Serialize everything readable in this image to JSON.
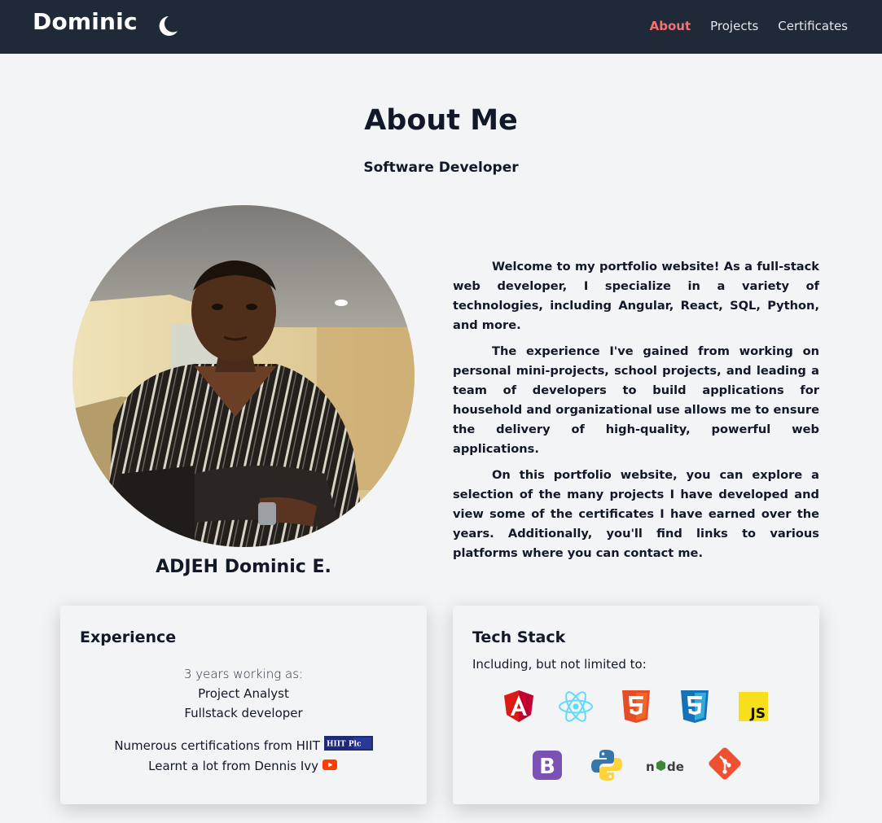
{
  "nav": {
    "brand": "Dominic",
    "theme_icon": "moon-icon",
    "links": [
      {
        "label": "About",
        "active": true
      },
      {
        "label": "Projects",
        "active": false
      },
      {
        "label": "Certificates",
        "active": false
      }
    ],
    "colors": {
      "background": "#1f2937",
      "active": "#f87171",
      "link": "#e5e7eb"
    }
  },
  "header": {
    "title": "About Me",
    "subtitle": "Software Developer"
  },
  "profile": {
    "photo_icon": "profile-photo",
    "name": "ADJEH Dominic E."
  },
  "bio": {
    "paragraphs": [
      "Welcome to my portfolio website! As a full-stack web developer, I specialize in a variety of technologies, including Angular, React, SQL, Python, and more.",
      "The experience I've gained from working on personal mini-projects, school projects, and leading a team of developers to build applications for household and organizational use allows me to ensure the delivery of high-quality, powerful web applications.",
      "On this portfolio website, you can explore a selection of the many projects I have developed and view some of the certificates I have earned over the years. Additionally, you'll find links to various platforms where you can contact me."
    ]
  },
  "experience": {
    "title": "Experience",
    "intro": "3 years working as:",
    "roles": [
      "Project Analyst",
      "Fullstack developer"
    ],
    "certifications": "Numerous certifications from HIIT",
    "certification_badge": "HIIT Plc",
    "learning": "Learnt a lot from Dennis Ivy",
    "learning_icon": "youtube-icon"
  },
  "tech_stack": {
    "title": "Tech Stack",
    "subtitle": "Including, but not limited to:",
    "icons": [
      "angular-icon",
      "react-icon",
      "html5-icon",
      "css3-icon",
      "javascript-icon",
      "bootstrap-icon",
      "python-icon",
      "nodejs-icon",
      "git-icon"
    ],
    "colors": {
      "angular": "#dd1b16",
      "react": "#61dafb",
      "html5": "#e44d26",
      "css3": "#1572b6",
      "javascript": "#f7df1e",
      "bootstrap": "#7952b3",
      "python_blue": "#3776ab",
      "python_yellow": "#ffd43b",
      "node": "#3c873a",
      "git": "#f05032"
    }
  }
}
